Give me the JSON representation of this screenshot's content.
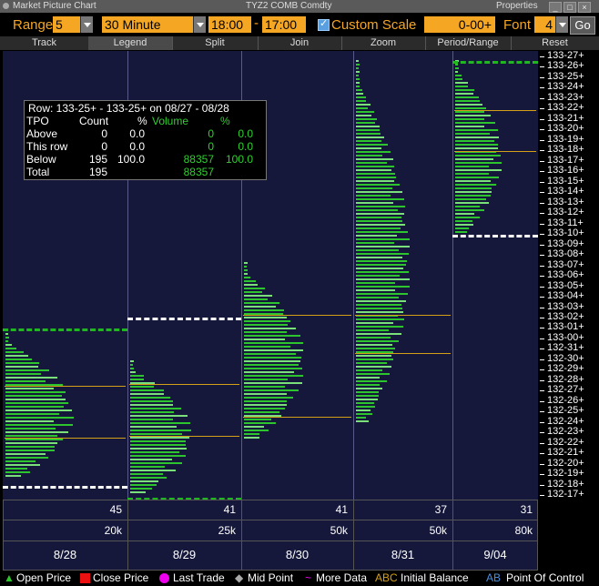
{
  "window": {
    "title": "Market Picture Chart",
    "security": "TYZ2 COMB Comdty",
    "properties": "Properties"
  },
  "toolbar": {
    "range_label": "Range",
    "range_value": "5",
    "interval_value": "30 Minute",
    "time_start": "18:00",
    "time_end": "17:00",
    "custom_scale_label": "Custom Scale",
    "scale_value": "0-00+",
    "font_label": "Font",
    "font_value": "4",
    "go_label": "Go"
  },
  "tabs": [
    "Track",
    "Legend",
    "Split",
    "Join",
    "Zoom",
    "Period/Range",
    "Reset"
  ],
  "price_axis": [
    "133-27+",
    "133-26+",
    "133-25+",
    "133-24+",
    "133-23+",
    "133-22+",
    "133-21+",
    "133-20+",
    "133-19+",
    "133-18+",
    "133-17+",
    "133-16+",
    "133-15+",
    "133-14+",
    "133-13+",
    "133-12+",
    "133-11+",
    "133-10+",
    "133-09+",
    "133-08+",
    "133-07+",
    "133-06+",
    "133-05+",
    "133-04+",
    "133-03+",
    "133-02+",
    "133-01+",
    "133-00+",
    "132-31+",
    "132-30+",
    "132-29+",
    "132-28+",
    "132-27+",
    "132-26+",
    "132-25+",
    "132-24+",
    "132-23+",
    "132-22+",
    "132-21+",
    "132-20+",
    "132-19+",
    "132-18+",
    "132-17+"
  ],
  "info_box": {
    "header": "Row:  133-25+ - 133-25+ on 08/27 - 08/28",
    "columns": [
      "TPO",
      "Count",
      "%",
      "Volume",
      "%"
    ],
    "rows": [
      {
        "label": "Above",
        "count": "0",
        "pct": "0.0",
        "volume": "0",
        "vpct": "0.0"
      },
      {
        "label": "This row",
        "count": "0",
        "pct": "0.0",
        "volume": "0",
        "vpct": "0.0"
      },
      {
        "label": "Below",
        "count": "195",
        "pct": "100.0",
        "volume": "88357",
        "vpct": "100.0"
      },
      {
        "label": "Total",
        "count": "195",
        "pct": "",
        "volume": "88357",
        "vpct": ""
      }
    ]
  },
  "sessions": [
    {
      "date": "8/28",
      "tpo": "45",
      "volume": "20k"
    },
    {
      "date": "8/29",
      "tpo": "41",
      "volume": "25k"
    },
    {
      "date": "8/30",
      "tpo": "41",
      "volume": "50k"
    },
    {
      "date": "8/31",
      "tpo": "37",
      "volume": "50k"
    },
    {
      "date": "9/04",
      "tpo": "31",
      "volume": "80k"
    }
  ],
  "legend": {
    "open_price": "Open Price",
    "close_price": "Close Price",
    "last_trade": "Last Trade",
    "mid_point": "Mid Point",
    "more_data": "More Data",
    "ib_abbrev": "ABC",
    "initial_balance": "Initial Balance",
    "poc_abbrev": "AB",
    "point_of_control": "Point Of Control"
  },
  "colors": {
    "accent": "#f5a623",
    "chart_bg": "#15183a",
    "volume_bar": "#2dc52d",
    "ref_line": "#d4a017"
  }
}
